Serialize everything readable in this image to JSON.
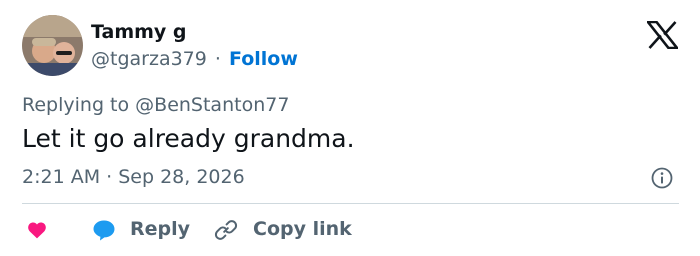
{
  "author": {
    "display_name": "Tammy g",
    "handle": "@tgarza379",
    "separator": "·",
    "follow_label": "Follow"
  },
  "reply_context": {
    "label": "Replying to @BenStanton77"
  },
  "tweet": {
    "text": "Let it go already grandma.",
    "timestamp": "2:21 AM · Sep 28, 2026"
  },
  "actions": {
    "reply_label": "Reply",
    "copy_link_label": "Copy link"
  },
  "colors": {
    "accent": "#0074d4",
    "heart": "#f91880",
    "reply_bubble": "#1d9bf0",
    "secondary_text": "#536471"
  },
  "icons": {
    "brand": "x-logo-icon",
    "like": "heart-icon",
    "reply": "reply-bubble-icon",
    "copy": "link-icon",
    "info": "info-icon"
  }
}
